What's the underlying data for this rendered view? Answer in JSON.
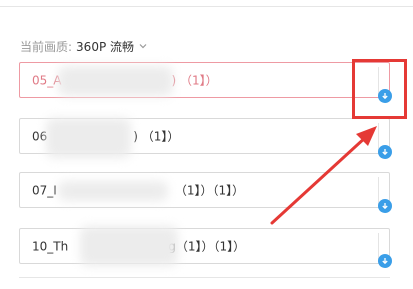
{
  "quality": {
    "label": "当前画质:",
    "value": "360P 流畅"
  },
  "items": [
    {
      "title": "05_A",
      "suffix": ") （1】）",
      "selected": true
    },
    {
      "title": "06",
      "suffix": ") （1】）",
      "selected": false
    },
    {
      "title": "07_I",
      "suffix": "（1】）（1】）",
      "selected": false
    },
    {
      "title": "10_Th",
      "suffix": "g（1】）（1】）",
      "selected": false
    }
  ],
  "colors": {
    "accent_blue": "#3a9ee8",
    "annotation_red": "#e53935",
    "selected_border": "#ee9aa3"
  },
  "icons": [
    "chevron-down-icon",
    "download-icon"
  ]
}
